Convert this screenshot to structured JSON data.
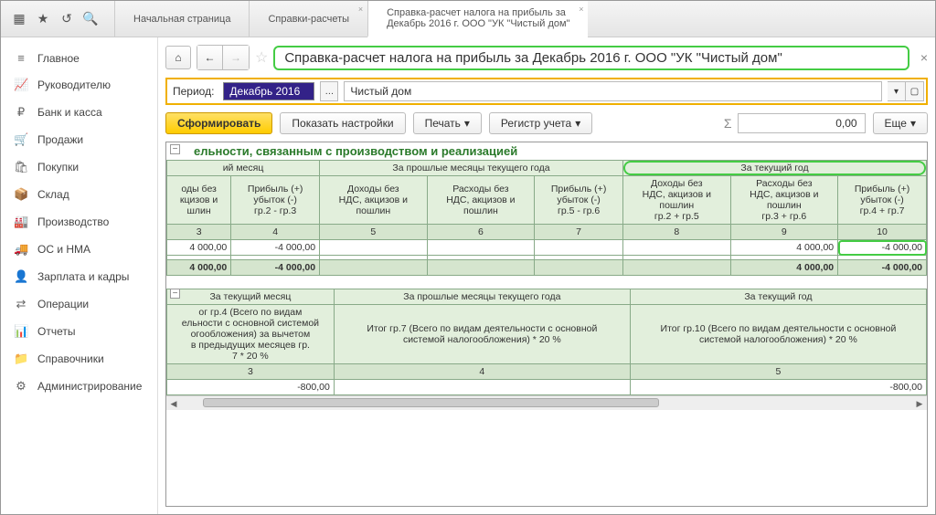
{
  "tabs": {
    "home": "Начальная страница",
    "refs": "Справки-расчеты",
    "current_l1": "Справка-расчет налога на прибыль  за",
    "current_l2": "Декабрь 2016 г. ООО \"УК \"Чистый дом\""
  },
  "sidebar": {
    "items": [
      {
        "label": "Главное",
        "icon": "≡"
      },
      {
        "label": "Руководителю",
        "icon": "📈"
      },
      {
        "label": "Банк и касса",
        "icon": "₽"
      },
      {
        "label": "Продажи",
        "icon": "🛒"
      },
      {
        "label": "Покупки",
        "icon": "🛍"
      },
      {
        "label": "Склад",
        "icon": "📦"
      },
      {
        "label": "Производство",
        "icon": "🏭"
      },
      {
        "label": "ОС и НМА",
        "icon": "🚚"
      },
      {
        "label": "Зарплата и кадры",
        "icon": "👤"
      },
      {
        "label": "Операции",
        "icon": "⇄"
      },
      {
        "label": "Отчеты",
        "icon": "📊"
      },
      {
        "label": "Справочники",
        "icon": "📁"
      },
      {
        "label": "Администрирование",
        "icon": "⚙"
      }
    ]
  },
  "page": {
    "title": "Справка-расчет налога на прибыль  за Декабрь 2016 г. ООО \"УК \"Чистый дом\""
  },
  "period": {
    "label": "Период:",
    "value": "Декабрь 2016",
    "org": "Чистый дом"
  },
  "actions": {
    "form": "Сформировать",
    "settings": "Показать настройки",
    "print": "Печать",
    "register": "Регистр учета",
    "more": "Еще"
  },
  "sum": {
    "symbol": "Σ",
    "value": "0,00"
  },
  "report1": {
    "section_title": "ельности, связанным с производством и реализацией",
    "group_month": "ий месяц",
    "group_prev": "За прошлые месяцы текущего года",
    "group_year": "За текущий год",
    "cols": {
      "c3h": "оды без\nкцизов и\nшлин",
      "c4h": "Прибыль (+)\nубыток (-)\nгр.2 - гр.3",
      "c5h": "Доходы без\nНДС, акцизов и\nпошлин",
      "c6h": "Расходы без\nНДС, акцизов и\nпошлин",
      "c7h": "Прибыль (+)\nубыток (-)\nгр.5 - гр.6",
      "c8h": "Доходы без\nНДС, акцизов и\nпошлин\nгр.2 + гр.5",
      "c9h": "Расходы без\nНДС, акцизов и\nпошлин\nгр.3 + гр.6",
      "c10h": "Прибыль (+)\nубыток (-)\nгр.4 + гр.7",
      "n3": "3",
      "n4": "4",
      "n5": "5",
      "n6": "6",
      "n7": "7",
      "n8": "8",
      "n9": "9",
      "n10": "10"
    },
    "row": {
      "c3": "4 000,00",
      "c4": "-4 000,00",
      "c9": "4 000,00",
      "c10": "-4 000,00"
    },
    "total": {
      "c3": "4 000,00",
      "c4": "-4 000,00",
      "c9": "4 000,00",
      "c10": "-4 000,00"
    }
  },
  "report2": {
    "group_month": "За текущий месяц",
    "group_prev": "За прошлые месяцы текущего года",
    "group_year": "За текущий год",
    "c3h": "ог гр.4 (Всего по видам\nельности с основной системой\nогообложения) за вычетом\nв предыдущих месяцев гр.\n7 * 20 %",
    "c4h": "Итог гр.7 (Всего по видам деятельности с основной\nсистемой налогообложения) * 20 %",
    "c5h": "Итог гр.10 (Всего по видам деятельности с основной\nсистемой налогообложения) * 20 %",
    "n3": "3",
    "n4": "4",
    "n5": "5",
    "row": {
      "c3": "-800,00",
      "c5": "-800,00"
    }
  }
}
